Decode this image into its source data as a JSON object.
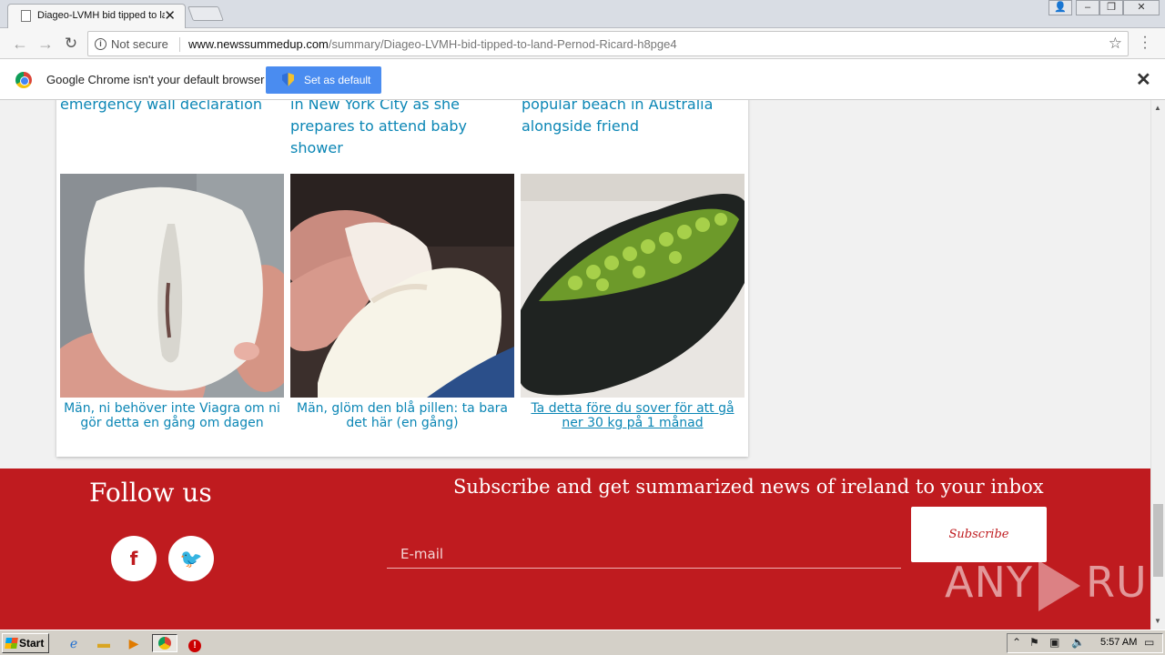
{
  "browser": {
    "tab_title": "Diageo-LVMH bid tipped to la",
    "security_label": "Not secure",
    "url_host": "www.newssummedup.com",
    "url_path": "/summary/Diageo-LVMH-bid-tipped-to-land-Pernod-Ricard-h8pge4",
    "infobar_message": "Google Chrome isn't your default browser",
    "set_default_label": "Set as default"
  },
  "content": {
    "top_captions": [
      "emergency wall declaration",
      "in New York City as she prepares to attend baby shower",
      "popular beach in Australia alongside friend"
    ],
    "ads": [
      {
        "caption": "Män, ni behöver inte Viagra om ni gör detta en gång om dagen"
      },
      {
        "caption": "Män, glöm den blå pillen: ta bara det här (en gång)"
      },
      {
        "caption": "Ta detta före du sover för att gå ner 30 kg på 1 månad"
      }
    ]
  },
  "footer": {
    "follow_label": "Follow us",
    "facebook_glyph": "f",
    "twitter_glyph": "🐦",
    "subscribe_title": "Subscribe and get summarized news of ireland to your inbox",
    "email_placeholder": "E-mail",
    "subscribe_button": "Subscribe",
    "watermark_left": "ANY",
    "watermark_right": "RUN"
  },
  "taskbar": {
    "start_label": "Start",
    "clock": "5:57 AM"
  },
  "colors": {
    "footer_red": "#bf1b1f",
    "link_blue": "#0b86b5",
    "button_blue": "#4a8cf0"
  }
}
